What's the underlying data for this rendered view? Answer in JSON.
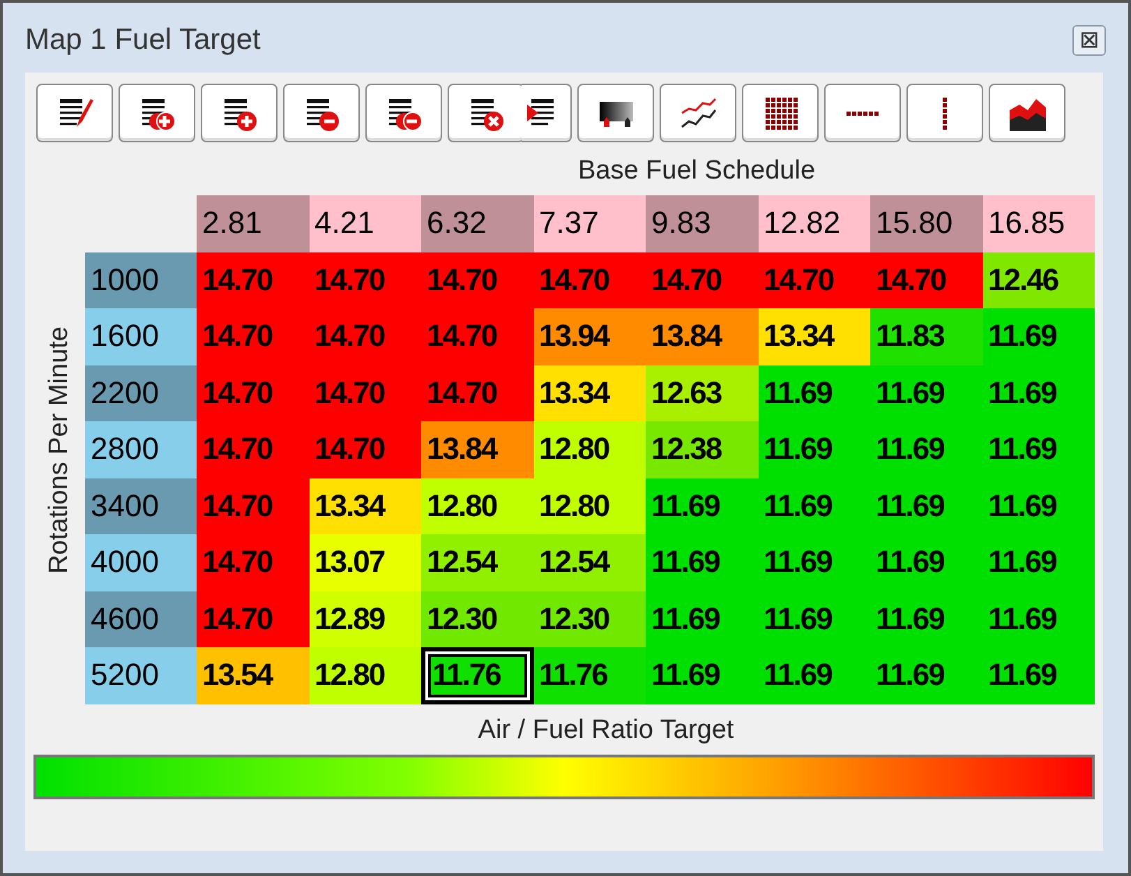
{
  "window": {
    "title": "Map 1 Fuel Target",
    "close": "⊠"
  },
  "toolbar": [
    {
      "kind": "edit"
    },
    {
      "kind": "insert-double"
    },
    {
      "kind": "insert"
    },
    {
      "kind": "remove"
    },
    {
      "kind": "remove-double"
    },
    {
      "kind": "delete"
    },
    {
      "kind": "list-arrow"
    },
    {
      "kind": "block"
    },
    {
      "kind": "lines"
    },
    {
      "kind": "grid"
    },
    {
      "kind": "row-dots"
    },
    {
      "kind": "column-dots"
    },
    {
      "kind": "area"
    }
  ],
  "table": {
    "title": "Base Fuel Schedule",
    "y_label": "Rotations Per Minute",
    "x_label": "Air / Fuel Ratio Target",
    "columns": [
      "2.81",
      "4.21",
      "6.32",
      "7.37",
      "9.83",
      "12.82",
      "15.80",
      "16.85"
    ],
    "rows": [
      {
        "rpm": "1000",
        "cells": [
          {
            "value": "14.70",
            "color": "#ff0000",
            "selected": false
          },
          {
            "value": "14.70",
            "color": "#ff0000",
            "selected": false
          },
          {
            "value": "14.70",
            "color": "#ff0000",
            "selected": false
          },
          {
            "value": "14.70",
            "color": "#ff0000",
            "selected": false
          },
          {
            "value": "14.70",
            "color": "#ff0000",
            "selected": false
          },
          {
            "value": "14.70",
            "color": "#ff0000",
            "selected": false
          },
          {
            "value": "14.70",
            "color": "#ff0000",
            "selected": false
          },
          {
            "value": "12.46",
            "color": "#80e800",
            "selected": false
          }
        ]
      },
      {
        "rpm": "1600",
        "cells": [
          {
            "value": "14.70",
            "color": "#ff0000",
            "selected": false
          },
          {
            "value": "14.70",
            "color": "#ff0000",
            "selected": false
          },
          {
            "value": "14.70",
            "color": "#ff0000",
            "selected": false
          },
          {
            "value": "13.94",
            "color": "#ff8c00",
            "selected": false
          },
          {
            "value": "13.84",
            "color": "#ff8c00",
            "selected": false
          },
          {
            "value": "13.34",
            "color": "#ffe000",
            "selected": false
          },
          {
            "value": "11.83",
            "color": "#20e000",
            "selected": false
          },
          {
            "value": "11.69",
            "color": "#00e000",
            "selected": false
          }
        ]
      },
      {
        "rpm": "2200",
        "cells": [
          {
            "value": "14.70",
            "color": "#ff0000",
            "selected": false
          },
          {
            "value": "14.70",
            "color": "#ff0000",
            "selected": false
          },
          {
            "value": "14.70",
            "color": "#ff0000",
            "selected": false
          },
          {
            "value": "13.34",
            "color": "#ffe000",
            "selected": false
          },
          {
            "value": "12.63",
            "color": "#a8f000",
            "selected": false
          },
          {
            "value": "11.69",
            "color": "#00e000",
            "selected": false
          },
          {
            "value": "11.69",
            "color": "#00e000",
            "selected": false
          },
          {
            "value": "11.69",
            "color": "#00e000",
            "selected": false
          }
        ]
      },
      {
        "rpm": "2800",
        "cells": [
          {
            "value": "14.70",
            "color": "#ff0000",
            "selected": false
          },
          {
            "value": "14.70",
            "color": "#ff0000",
            "selected": false
          },
          {
            "value": "13.84",
            "color": "#ff8c00",
            "selected": false
          },
          {
            "value": "12.80",
            "color": "#c0ff00",
            "selected": false
          },
          {
            "value": "12.38",
            "color": "#78e800",
            "selected": false
          },
          {
            "value": "11.69",
            "color": "#00e000",
            "selected": false
          },
          {
            "value": "11.69",
            "color": "#00e000",
            "selected": false
          },
          {
            "value": "11.69",
            "color": "#00e000",
            "selected": false
          }
        ]
      },
      {
        "rpm": "3400",
        "cells": [
          {
            "value": "14.70",
            "color": "#ff0000",
            "selected": false
          },
          {
            "value": "13.34",
            "color": "#ffe000",
            "selected": false
          },
          {
            "value": "12.80",
            "color": "#c0ff00",
            "selected": false
          },
          {
            "value": "12.80",
            "color": "#c0ff00",
            "selected": false
          },
          {
            "value": "11.69",
            "color": "#00e000",
            "selected": false
          },
          {
            "value": "11.69",
            "color": "#00e000",
            "selected": false
          },
          {
            "value": "11.69",
            "color": "#00e000",
            "selected": false
          },
          {
            "value": "11.69",
            "color": "#00e000",
            "selected": false
          }
        ]
      },
      {
        "rpm": "4000",
        "cells": [
          {
            "value": "14.70",
            "color": "#ff0000",
            "selected": false
          },
          {
            "value": "13.07",
            "color": "#e8ff00",
            "selected": false
          },
          {
            "value": "12.54",
            "color": "#90f000",
            "selected": false
          },
          {
            "value": "12.54",
            "color": "#90f000",
            "selected": false
          },
          {
            "value": "11.69",
            "color": "#00e000",
            "selected": false
          },
          {
            "value": "11.69",
            "color": "#00e000",
            "selected": false
          },
          {
            "value": "11.69",
            "color": "#00e000",
            "selected": false
          },
          {
            "value": "11.69",
            "color": "#00e000",
            "selected": false
          }
        ]
      },
      {
        "rpm": "4600",
        "cells": [
          {
            "value": "14.70",
            "color": "#ff0000",
            "selected": false
          },
          {
            "value": "12.89",
            "color": "#d0ff00",
            "selected": false
          },
          {
            "value": "12.30",
            "color": "#70e800",
            "selected": false
          },
          {
            "value": "12.30",
            "color": "#70e800",
            "selected": false
          },
          {
            "value": "11.69",
            "color": "#00e000",
            "selected": false
          },
          {
            "value": "11.69",
            "color": "#00e000",
            "selected": false
          },
          {
            "value": "11.69",
            "color": "#00e000",
            "selected": false
          },
          {
            "value": "11.69",
            "color": "#00e000",
            "selected": false
          }
        ]
      },
      {
        "rpm": "5200",
        "cells": [
          {
            "value": "13.54",
            "color": "#ffc000",
            "selected": false
          },
          {
            "value": "12.80",
            "color": "#c0ff00",
            "selected": false
          },
          {
            "value": "11.76",
            "color": "#10e000",
            "selected": true
          },
          {
            "value": "11.76",
            "color": "#10e000",
            "selected": false
          },
          {
            "value": "11.69",
            "color": "#00e000",
            "selected": false
          },
          {
            "value": "11.69",
            "color": "#00e000",
            "selected": false
          },
          {
            "value": "11.69",
            "color": "#00e000",
            "selected": false
          },
          {
            "value": "11.69",
            "color": "#00e000",
            "selected": false
          }
        ]
      }
    ]
  }
}
